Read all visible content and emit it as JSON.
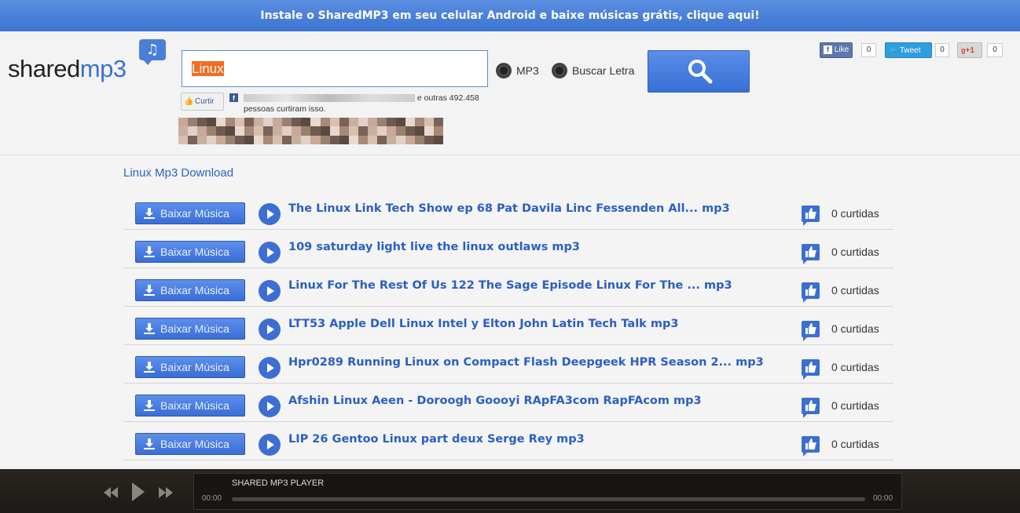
{
  "banner": {
    "text": "Instale o SharedMP3 em seu celular Android e baixe músicas grátis, clique aqui!"
  },
  "logo": {
    "part1": "shared",
    "part2": "mp3",
    "note": "♫"
  },
  "search": {
    "value": "Linux"
  },
  "options": {
    "mp3": "MP3",
    "lyrics": "Buscar Letra"
  },
  "facebook": {
    "curtir": "Curtir",
    "f": "f",
    "text_rest": " e outras 492.458 pessoas curtiram isso."
  },
  "social": {
    "like": "Like",
    "like_count": "0",
    "tweet": "Tweet",
    "tweet_count": "0",
    "gplus": "+1",
    "gplus_count": "0"
  },
  "results": {
    "title": "Linux Mp3 Download",
    "download_label": "Baixar Música",
    "items": [
      {
        "title": "The Linux Link Tech Show ep 68 Pat Davila Linc Fessenden All... mp3",
        "likes": "0 curtidas"
      },
      {
        "title": "109 saturday light live the linux outlaws mp3",
        "likes": "0 curtidas"
      },
      {
        "title": "Linux For The Rest Of Us 122 The Sage Episode Linux For The ... mp3",
        "likes": "0 curtidas"
      },
      {
        "title": "LTT53 Apple Dell Linux Intel y Elton John Latin Tech Talk mp3",
        "likes": "0 curtidas"
      },
      {
        "title": "Hpr0289 Running Linux on Compact Flash Deepgeek HPR Season 2... mp3",
        "likes": "0 curtidas"
      },
      {
        "title": "Afshin Linux Aeen - Doroogh Goooyi RApFA3com RapFAcom mp3",
        "likes": "0 curtidas"
      },
      {
        "title": "LIP 26 Gentoo Linux part deux Serge Rey mp3",
        "likes": "0 curtidas"
      }
    ]
  },
  "player": {
    "title": "SHARED MP3 PLAYER",
    "time_start": "00:00",
    "time_end": "00:00",
    "progress": 0
  }
}
